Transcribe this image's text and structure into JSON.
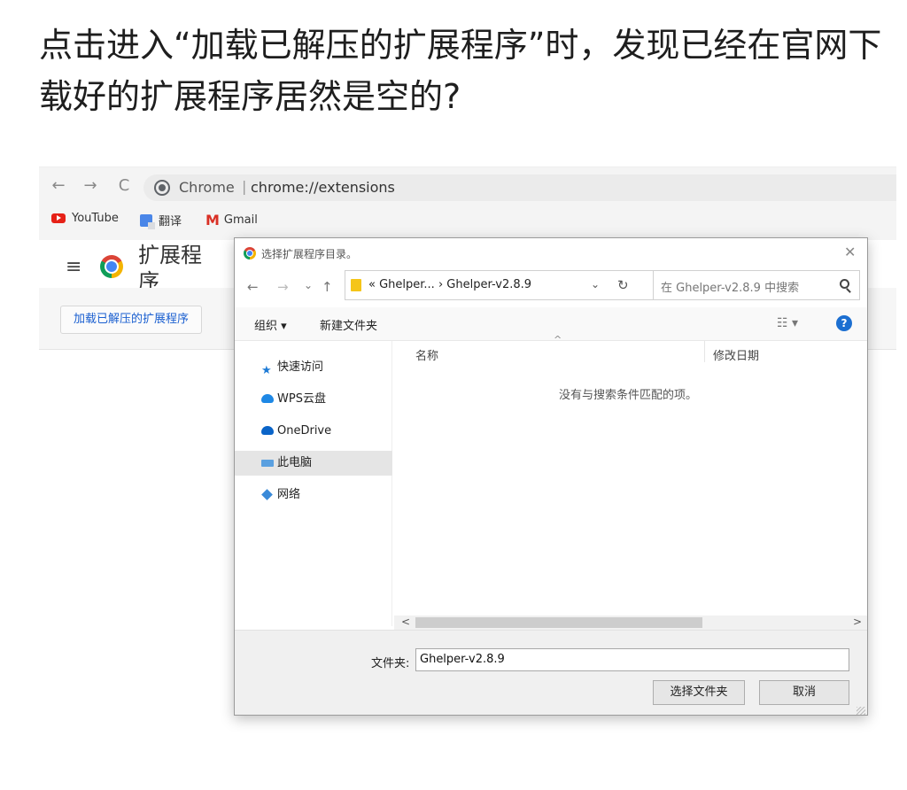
{
  "post": {
    "headline": "点击进入“加载已解压的扩展程序”时，发现已经在官网下载好的扩展程序居然是空的?"
  },
  "browser": {
    "nav": {
      "back": "←",
      "forward": "→",
      "reload": "C"
    },
    "site_chip": "Chrome",
    "separator": "|",
    "url": "chrome://extensions",
    "bookmarks": [
      {
        "label": "YouTube",
        "icon": "youtube-icon"
      },
      {
        "label": "翻译",
        "icon": "translate-icon"
      },
      {
        "label": "Gmail",
        "icon": "gmail-icon"
      }
    ],
    "gmail_glyph": "M",
    "menu_glyph": "≡",
    "page_title": "扩展程序",
    "load_unpacked_label": "加载已解压的扩展程序"
  },
  "dialog": {
    "title": "选择扩展程序目录。",
    "close_glyph": "✕",
    "nav": {
      "back": "←",
      "forward": "→",
      "recent": "⌄",
      "up": "↑"
    },
    "breadcrumb": "« Ghelper... › Ghelper-v2.8.9",
    "dropdown_glyph": "⌄",
    "refresh_glyph": "↻",
    "search_placeholder": "在 Ghelper-v2.8.9 中搜索",
    "organize_label": "组织 ▾",
    "new_folder_label": "新建文件夹",
    "view_glyph": "☷ ▾",
    "help_glyph": "?",
    "nav_pane": [
      {
        "label": "快速访问",
        "icon": "star-icon",
        "selected": false
      },
      {
        "label": "WPS云盘",
        "icon": "cloud-icon",
        "selected": false
      },
      {
        "label": "OneDrive",
        "icon": "onedrive-icon",
        "selected": false
      },
      {
        "label": "此电脑",
        "icon": "computer-icon",
        "selected": true
      },
      {
        "label": "网络",
        "icon": "network-icon",
        "selected": false
      }
    ],
    "star_glyph": "★",
    "columns": {
      "name": "名称",
      "modified": "修改日期"
    },
    "sort_glyph": "^",
    "empty_message": "没有与搜索条件匹配的项。",
    "scroll": {
      "left": "<",
      "right": ">"
    },
    "folder_label": "文件夹:",
    "folder_value": "Ghelper-v2.8.9",
    "select_folder_label": "选择文件夹",
    "cancel_label": "取消"
  },
  "colors": {
    "accent_link": "#1a5fd0",
    "youtube_red": "#e62117",
    "help_blue": "#1c6fd1"
  }
}
